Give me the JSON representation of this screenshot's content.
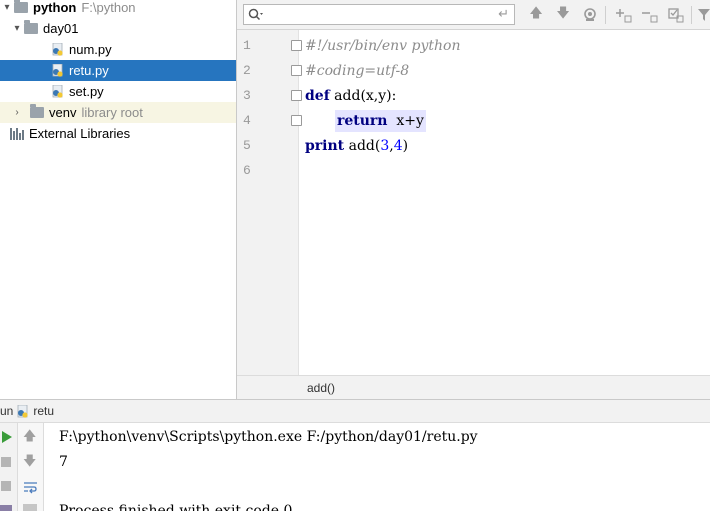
{
  "project_tree": {
    "root": {
      "name": "python",
      "path": "F:\\python"
    },
    "folder": {
      "name": "day01"
    },
    "files": [
      "num.py",
      "retu.py",
      "set.py"
    ],
    "venv": {
      "name": "venv",
      "sub": "library root"
    },
    "external": "External Libraries"
  },
  "editor": {
    "search_placeholder": "",
    "line_numbers": [
      "1",
      "2",
      "3",
      "4",
      "5",
      "6"
    ],
    "code": {
      "line1": "#!/usr/bin/env python",
      "line2": "#coding=utf-8",
      "line3_kw": "def",
      "line3_rest": " add(x,y):",
      "line4_kw": "return",
      "line4_rest": "  x+y",
      "line5_kw": "print",
      "line5_fn": " add(",
      "line5_a": "3",
      "line5_comma": ",",
      "line5_b": "4",
      "line5_close": ")"
    },
    "breadcrumb": "add()"
  },
  "run_panel": {
    "tab_prefix": "un",
    "tab_name": "retu",
    "console": {
      "command": "F:\\python\\venv\\Scripts\\python.exe F:/python/day01/retu.py",
      "output": "7",
      "finished": "Process finished with exit code 0"
    }
  },
  "colors": {
    "selection": "#2675bf",
    "keyword": "#000080",
    "comment": "#8c8c8c",
    "number": "#0000ff",
    "line_highlight": "#e4e4ff",
    "run_green": "#3a9c3a"
  }
}
